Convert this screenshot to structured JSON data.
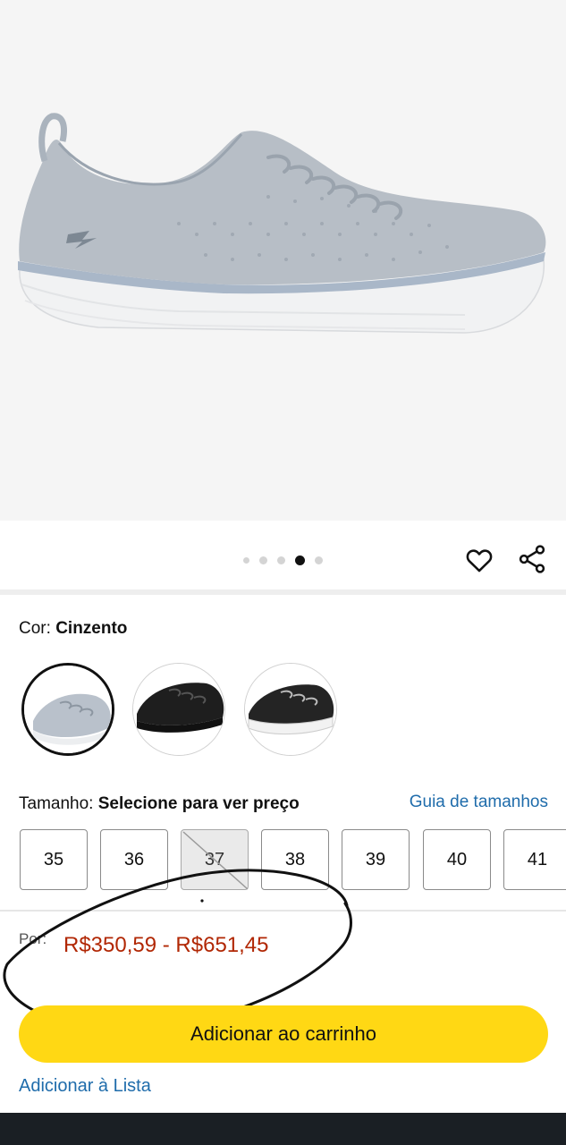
{
  "gallery": {
    "dot_count": 5,
    "active_dot": 3
  },
  "actions": {
    "favorite_icon": "heart-icon",
    "share_icon": "share-icon"
  },
  "color": {
    "label": "Cor:",
    "value": "Cinzento",
    "swatches": [
      {
        "name": "Cinzento",
        "selected": true
      },
      {
        "name": "Preto",
        "selected": false
      },
      {
        "name": "Preto/Branco",
        "selected": false
      }
    ]
  },
  "size": {
    "label": "Tamanho:",
    "prompt": "Selecione para ver preço",
    "guide_link": "Guia de tamanhos",
    "options": [
      {
        "label": "35",
        "available": true
      },
      {
        "label": "36",
        "available": true
      },
      {
        "label": "37",
        "available": false
      },
      {
        "label": "38",
        "available": true
      },
      {
        "label": "39",
        "available": true
      },
      {
        "label": "40",
        "available": true
      },
      {
        "label": "41",
        "available": true
      }
    ]
  },
  "price": {
    "label": "Por:",
    "range": "R$350,59 - R$651,45"
  },
  "buttons": {
    "add_to_cart": "Adicionar ao carrinho",
    "add_to_list": "Adicionar à Lista"
  },
  "colors": {
    "price": "#b12704",
    "link": "#1f6cab",
    "cart_button": "#ffd814"
  }
}
